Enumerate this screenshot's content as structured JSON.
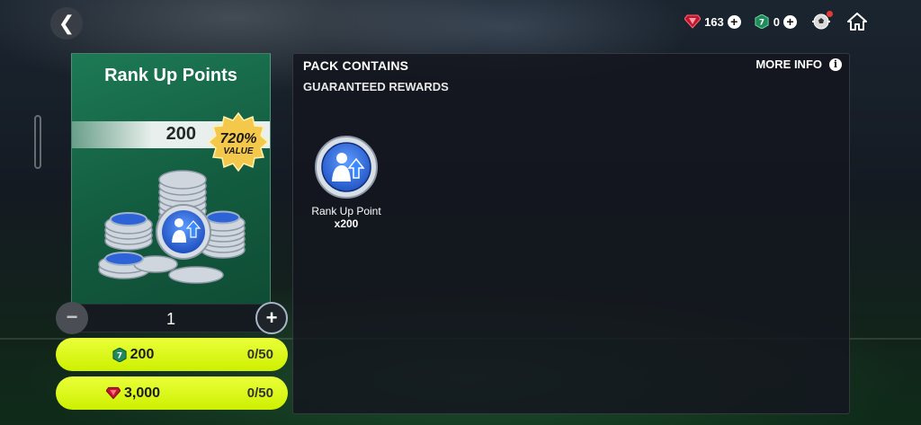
{
  "topbar": {
    "back_symbol": "❮",
    "gems": "163",
    "tokens": "0"
  },
  "card": {
    "title": "Rank Up Points",
    "amount": "200",
    "value_percent": "720%",
    "value_label": "VALUE"
  },
  "quantity": {
    "value": "1",
    "minus_symbol": "−",
    "plus_symbol": "+"
  },
  "buy_options": [
    {
      "price": "200",
      "limit": "0/50",
      "currency_icon": "token-icon",
      "color": "#1f8a5a"
    },
    {
      "price": "3,000",
      "limit": "0/50",
      "currency_icon": "gem-icon",
      "color": "#c2162c"
    }
  ],
  "panel": {
    "title": "PACK CONTAINS",
    "more_info": "MORE INFO",
    "subtitle": "GUARANTEED REWARDS",
    "rewards": [
      {
        "label": "Rank Up Point",
        "quantity": "x200"
      }
    ]
  },
  "colors": {
    "accent_yellow": "#d9f700",
    "card_green": "#17694a",
    "gem_red": "#c2162c",
    "token_green": "#1f8a5a"
  }
}
